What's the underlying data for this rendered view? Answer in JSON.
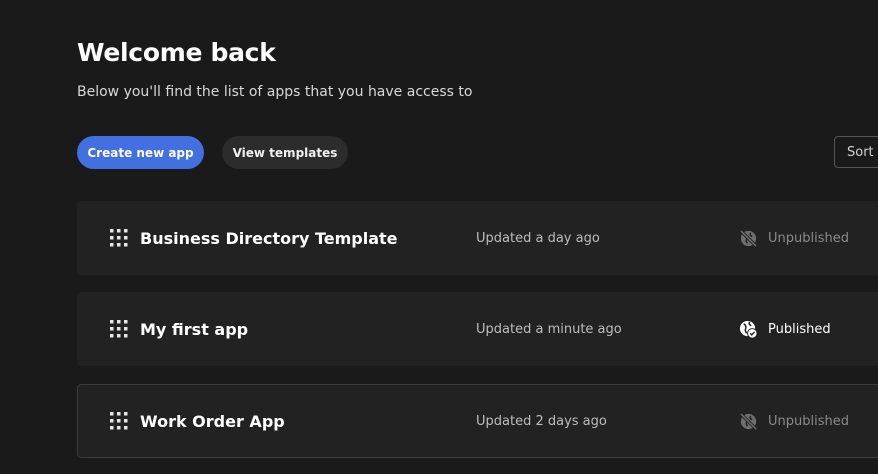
{
  "header": {
    "title": "Welcome back",
    "subtitle": "Below you'll find the list of apps that you have access to"
  },
  "actions": {
    "create_label": "Create new app",
    "templates_label": "View templates",
    "sort_label": "Sort by"
  },
  "apps": [
    {
      "name": "Business Directory Template",
      "updated": "Updated a day ago",
      "status": "Unpublished",
      "status_icon": "unpublished-globe-icon"
    },
    {
      "name": "My first app",
      "updated": "Updated a minute ago",
      "status": "Published",
      "status_icon": "published-globe-icon"
    },
    {
      "name": "Work Order App",
      "updated": "Updated 2 days ago",
      "status": "Unpublished",
      "status_icon": "unpublished-globe-icon"
    }
  ],
  "colors": {
    "background": "#1a1a1a",
    "row_background": "#222222",
    "primary_button": "#4270e0",
    "secondary_button": "#2c2c2c",
    "unpublished_text": "#8a8a8a",
    "published_text": "#ffffff"
  }
}
